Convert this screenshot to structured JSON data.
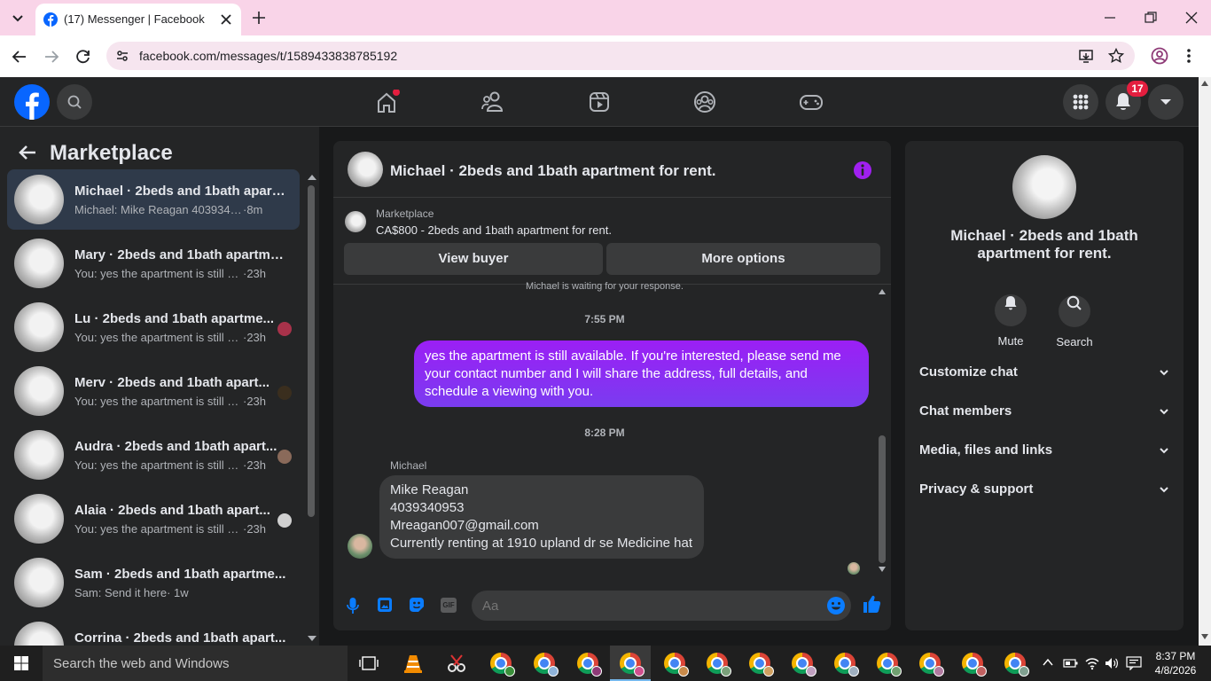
{
  "browser": {
    "tab_title": "(17) Messenger | Facebook",
    "url": "facebook.com/messages/t/1589433838785192"
  },
  "fb": {
    "notification_count": "17"
  },
  "sidebar": {
    "heading": "Marketplace",
    "conversations": [
      {
        "name": "Michael · 2beds and 1bath apart...",
        "snippet": "Michael: Mike Reagan 4039340953...",
        "time": "·8m",
        "active": true
      },
      {
        "name": "Mary · 2beds and 1bath apartme...",
        "snippet": "You: yes the apartment is still avail...",
        "time": "·23h"
      },
      {
        "name": "Lu · 2beds and 1bath apartme...",
        "snippet": "You: yes the apartment is still a...",
        "time": "·23h"
      },
      {
        "name": "Merv · 2beds and 1bath apart...",
        "snippet": "You: yes the apartment is still a...",
        "time": "·23h"
      },
      {
        "name": "Audra · 2beds and 1bath apart...",
        "snippet": "You: yes the apartment is still a...",
        "time": "·23h"
      },
      {
        "name": "Alaia · 2beds and 1bath apart...",
        "snippet": "You: yes the apartment is still a...",
        "time": "·23h"
      },
      {
        "name": "Sam · 2beds and 1bath apartme...",
        "snippet": "Sam: Send it here",
        "time": "· 1w"
      },
      {
        "name": "Corrina · 2beds and 1bath apart...",
        "snippet": "",
        "time": ""
      }
    ]
  },
  "chat": {
    "title": "Michael · 2beds and 1bath apartment for rent.",
    "listing_label": "Marketplace",
    "listing_price": "CA$800 - 2beds and 1bath apartment for rent.",
    "view_buyer": "View buyer",
    "more_options": "More options",
    "waiting_notice": "Michael is waiting for your response.",
    "time1": "7:55 PM",
    "outgoing": "yes the apartment is still available. If you're interested, please send me your contact number and I will share the address, full details, and schedule a viewing with you.",
    "time2": "8:28 PM",
    "sender": "Michael",
    "incoming_lines": [
      "Mike Reagan",
      "4039340953",
      "Mreagan007@gmail.com",
      "Currently renting at 1910 upland dr se Medicine hat"
    ],
    "composer_placeholder": "Aa"
  },
  "info": {
    "name": "Michael · 2beds and 1bath apartment for rent.",
    "mute": "Mute",
    "search": "Search",
    "sections": [
      "Customize chat",
      "Chat members",
      "Media, files and links",
      "Privacy & support"
    ]
  },
  "taskbar": {
    "search_placeholder": "Search the web and Windows",
    "time": "8:37 PM",
    "date": "4/8/2026"
  },
  "colors": {
    "accent": "#8a2be2",
    "fb_blue": "#0866ff",
    "messenger_blue": "#0a7cff"
  }
}
